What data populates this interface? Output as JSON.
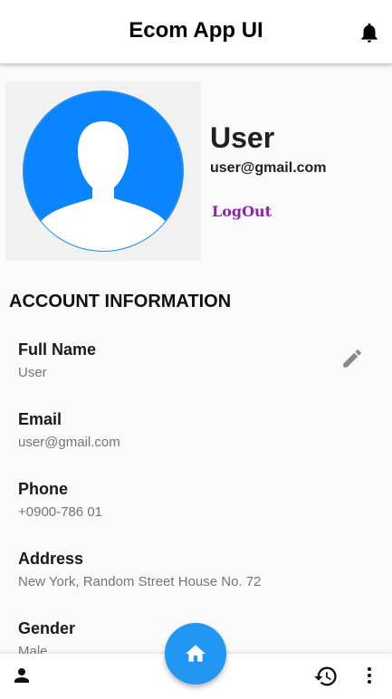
{
  "appbar": {
    "title": "Ecom App UI",
    "notification_icon": "bell-icon"
  },
  "profile": {
    "avatar_icon": "person-silhouette-icon",
    "name": "User",
    "email": "user@gmail.com",
    "logout_label": "LogOut"
  },
  "account": {
    "section_title": "ACCOUNT INFORMATION",
    "edit_icon": "pencil-icon",
    "fields": [
      {
        "label": "Full Name",
        "value": "User"
      },
      {
        "label": "Email",
        "value": "user@gmail.com"
      },
      {
        "label": "Phone",
        "value": "+0900-786 01"
      },
      {
        "label": "Address",
        "value": "New York, Random Street House No. 72"
      },
      {
        "label": "Gender",
        "value": "Male"
      }
    ]
  },
  "bottom_nav": {
    "left_icon": "person-icon",
    "fab_icon": "home-icon",
    "history_icon": "history-icon",
    "more_icon": "more-vertical-icon"
  },
  "colors": {
    "accent": "#2196f3",
    "avatar_blue": "#0a84ff",
    "logout_purple": "#8e24aa"
  }
}
